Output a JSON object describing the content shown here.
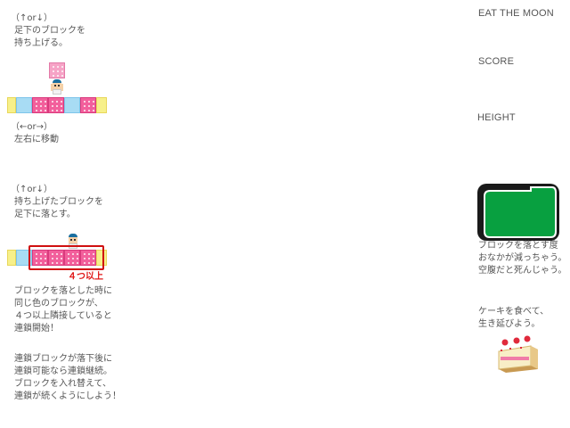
{
  "hud": {
    "title": "EAT THE MOON",
    "score_label": "SCORE",
    "height_label": "HEIGHT"
  },
  "tutorial": {
    "lift": {
      "keys": "（↑or↓）",
      "line1": "足下のブロックを",
      "line2": "持ち上げる。"
    },
    "move": {
      "keys": "（←or→）",
      "line1": "左右に移動"
    },
    "drop": {
      "keys": "（↑or↓）",
      "line1": "持ち上げたブロックを",
      "line2": "足下に落とす。"
    },
    "chain_count_label": "４つ以上",
    "chain_start": {
      "line1": "ブロックを落とした時に",
      "line2": "同じ色のブロックが、",
      "line3": "４つ以上隣接していると",
      "line4": "連鎖開始！"
    },
    "chain_continue": {
      "line1": "連鎖ブロックが落下後に",
      "line2": "連鎖可能なら連鎖継続。",
      "line3": "ブロックを入れ替えて、",
      "line4": "連鎖が続くようにしよう！"
    }
  },
  "side": {
    "hunger": {
      "line1": "ブロックを落とす度",
      "line2": "おなかが減っちゃう。",
      "line3": "空腹だと死んじゃう。"
    },
    "cake": {
      "line1": "ケーキを食べて、",
      "line2": "生き延びよう。"
    }
  },
  "colors": {
    "pink_block": "#f2609c",
    "blue_block": "#a8dcf4",
    "yellow_block": "#f7f08a",
    "stomach_fill": "#08a040",
    "stomach_frame": "#1a1a1a",
    "highlight": "#d01010"
  },
  "stomach_fill_fraction": 0.85
}
